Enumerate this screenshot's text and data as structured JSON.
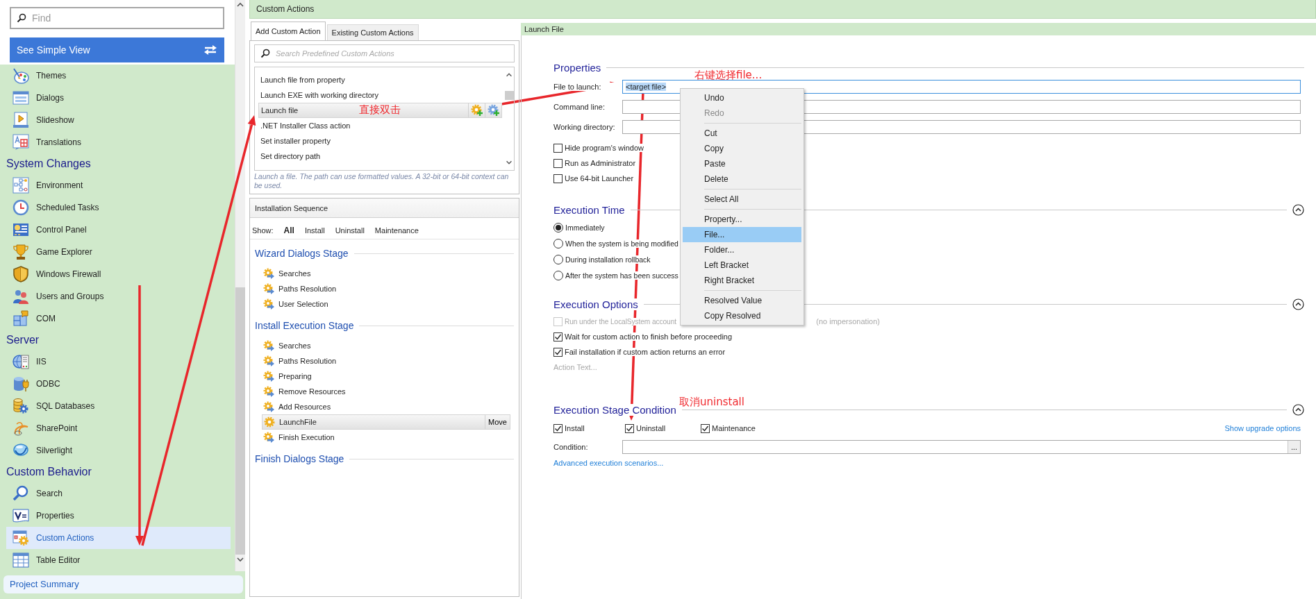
{
  "sidebar": {
    "search": {
      "placeholder": "Find"
    },
    "view_button": {
      "label": "See Simple View"
    },
    "sections": [
      {
        "items": [
          {
            "label": "Themes",
            "selected": false
          },
          {
            "label": "Dialogs",
            "selected": false
          },
          {
            "label": "Slideshow",
            "selected": false
          },
          {
            "label": "Translations",
            "selected": false
          }
        ]
      },
      {
        "title": "System Changes",
        "items": [
          {
            "label": "Environment",
            "selected": false
          },
          {
            "label": "Scheduled Tasks",
            "selected": false
          },
          {
            "label": "Control Panel",
            "selected": false
          },
          {
            "label": "Game Explorer",
            "selected": false
          },
          {
            "label": "Windows Firewall",
            "selected": false
          },
          {
            "label": "Users and Groups",
            "selected": false
          },
          {
            "label": "COM",
            "selected": false
          }
        ]
      },
      {
        "title": "Server",
        "items": [
          {
            "label": "IIS",
            "selected": false
          },
          {
            "label": "ODBC",
            "selected": false
          },
          {
            "label": "SQL Databases",
            "selected": false
          },
          {
            "label": "SharePoint",
            "selected": false
          },
          {
            "label": "Silverlight",
            "selected": false
          }
        ]
      },
      {
        "title": "Custom Behavior",
        "items": [
          {
            "label": "Search",
            "selected": false
          },
          {
            "label": "Properties",
            "selected": false
          },
          {
            "label": "Custom Actions",
            "selected": true
          },
          {
            "label": "Table Editor",
            "selected": false
          }
        ]
      }
    ],
    "footer": {
      "label": "Project Summary"
    }
  },
  "page_title": "Custom Actions",
  "add_panel": {
    "tabs": [
      {
        "label": "Add Custom Action",
        "selected": true
      },
      {
        "label": "Existing Custom Actions",
        "selected": false
      }
    ],
    "search": {
      "placeholder": "Search Predefined Custom Actions"
    },
    "actions": [
      {
        "label": "Launch file from property",
        "selected": false
      },
      {
        "label": "Launch EXE with working directory",
        "selected": false
      },
      {
        "label": "Launch file",
        "selected": true
      },
      {
        "label": ".NET Installer Class action",
        "selected": false
      },
      {
        "label": "Set installer property",
        "selected": false
      },
      {
        "label": "Set directory path",
        "selected": false
      }
    ],
    "description": "Launch a file. The path can use formatted values. A 32-bit or 64-bit context can be used."
  },
  "installation_sequence": {
    "title": "Installation Sequence",
    "show_label": "Show:",
    "filters": [
      {
        "label": "All",
        "selected": true
      },
      {
        "label": "Install",
        "selected": false
      },
      {
        "label": "Uninstall",
        "selected": false
      },
      {
        "label": "Maintenance",
        "selected": false
      }
    ],
    "stages": [
      {
        "title": "Wizard Dialogs Stage",
        "items": [
          {
            "label": "Searches",
            "kind": "step",
            "selected": false
          },
          {
            "label": "Paths Resolution",
            "kind": "step",
            "selected": false
          },
          {
            "label": "User Selection",
            "kind": "step",
            "selected": false
          }
        ]
      },
      {
        "title": "Install Execution Stage",
        "items": [
          {
            "label": "Searches",
            "kind": "step",
            "selected": false
          },
          {
            "label": "Paths Resolution",
            "kind": "step",
            "selected": false
          },
          {
            "label": "Preparing",
            "kind": "step",
            "selected": false
          },
          {
            "label": "Remove Resources",
            "kind": "step",
            "selected": false
          },
          {
            "label": "Add Resources",
            "kind": "step",
            "selected": false
          },
          {
            "label": "LaunchFile",
            "kind": "action",
            "selected": true,
            "button": "Move"
          },
          {
            "label": "Finish Execution",
            "kind": "step",
            "selected": false
          }
        ]
      },
      {
        "title": "Finish Dialogs Stage"
      }
    ]
  },
  "launch_file": {
    "title": "Launch File",
    "properties": {
      "title": "Properties",
      "fields": [
        {
          "label": "File to launch:",
          "value": "<target file>",
          "focused": true
        },
        {
          "label": "Command line:",
          "focused": false
        },
        {
          "label": "Working directory:",
          "focused": false
        }
      ],
      "options": [
        {
          "label": "Hide program's window",
          "checked": false
        },
        {
          "label": "Run as Administrator",
          "checked": false
        },
        {
          "label": "Use 64-bit Launcher",
          "checked": false
        }
      ]
    },
    "execution_time": {
      "title": "Execution Time",
      "expanded": true,
      "choices": [
        {
          "label": "Immediately",
          "selected": true
        },
        {
          "label": "When the system is being modified",
          "selected": false
        },
        {
          "label": "During installation rollback",
          "selected": false
        },
        {
          "label": "After the system has been success",
          "selected": false
        }
      ]
    },
    "execution_options": {
      "title": "Execution Options",
      "expanded": true,
      "options": [
        {
          "label": "Run under the LocalSystem account",
          "tail": "(no impersonation)",
          "checked": false,
          "disabled": true
        },
        {
          "label": "Wait for custom action to finish before proceeding",
          "checked": true,
          "disabled": false
        },
        {
          "label": "Fail installation if custom action returns an error",
          "checked": true,
          "disabled": false
        }
      ],
      "link": {
        "label": "Action Text...",
        "disabled": true
      }
    },
    "stage_condition": {
      "title": "Execution Stage Condition",
      "expanded": true,
      "options": [
        {
          "label": "Install",
          "checked": true
        },
        {
          "label": "Uninstall",
          "checked": true
        },
        {
          "label": "Maintenance",
          "checked": true
        }
      ],
      "upgrade_link": "Show upgrade options",
      "condition": {
        "label": "Condition:",
        "button": "..."
      },
      "advanced_link": "Advanced execution scenarios..."
    }
  },
  "context_menu": {
    "groups": [
      {
        "items": [
          {
            "label": "Undo",
            "disabled": false,
            "selected": false
          },
          {
            "label": "Redo",
            "disabled": true,
            "selected": false
          }
        ]
      },
      {
        "items": [
          {
            "label": "Cut",
            "disabled": false,
            "selected": false
          },
          {
            "label": "Copy",
            "disabled": false,
            "selected": false
          },
          {
            "label": "Paste",
            "disabled": false,
            "selected": false
          },
          {
            "label": "Delete",
            "disabled": false,
            "selected": false
          }
        ]
      },
      {
        "items": [
          {
            "label": "Select All",
            "disabled": false,
            "selected": false
          }
        ]
      },
      {
        "items": [
          {
            "label": "Property...",
            "disabled": false,
            "selected": false
          },
          {
            "label": "File...",
            "disabled": false,
            "selected": true
          },
          {
            "label": "Folder...",
            "disabled": false,
            "selected": false
          },
          {
            "label": "Left Bracket",
            "disabled": false,
            "selected": false
          },
          {
            "label": "Right Bracket",
            "disabled": false,
            "selected": false
          }
        ]
      },
      {
        "items": [
          {
            "label": "Resolved Value",
            "disabled": false,
            "selected": false
          },
          {
            "label": "Copy Resolved",
            "disabled": false,
            "selected": false
          }
        ]
      }
    ]
  },
  "annotations": [
    {
      "text": "直接双击"
    },
    {
      "text": "右键选择file..."
    },
    {
      "text": "取消uninstall"
    }
  ]
}
